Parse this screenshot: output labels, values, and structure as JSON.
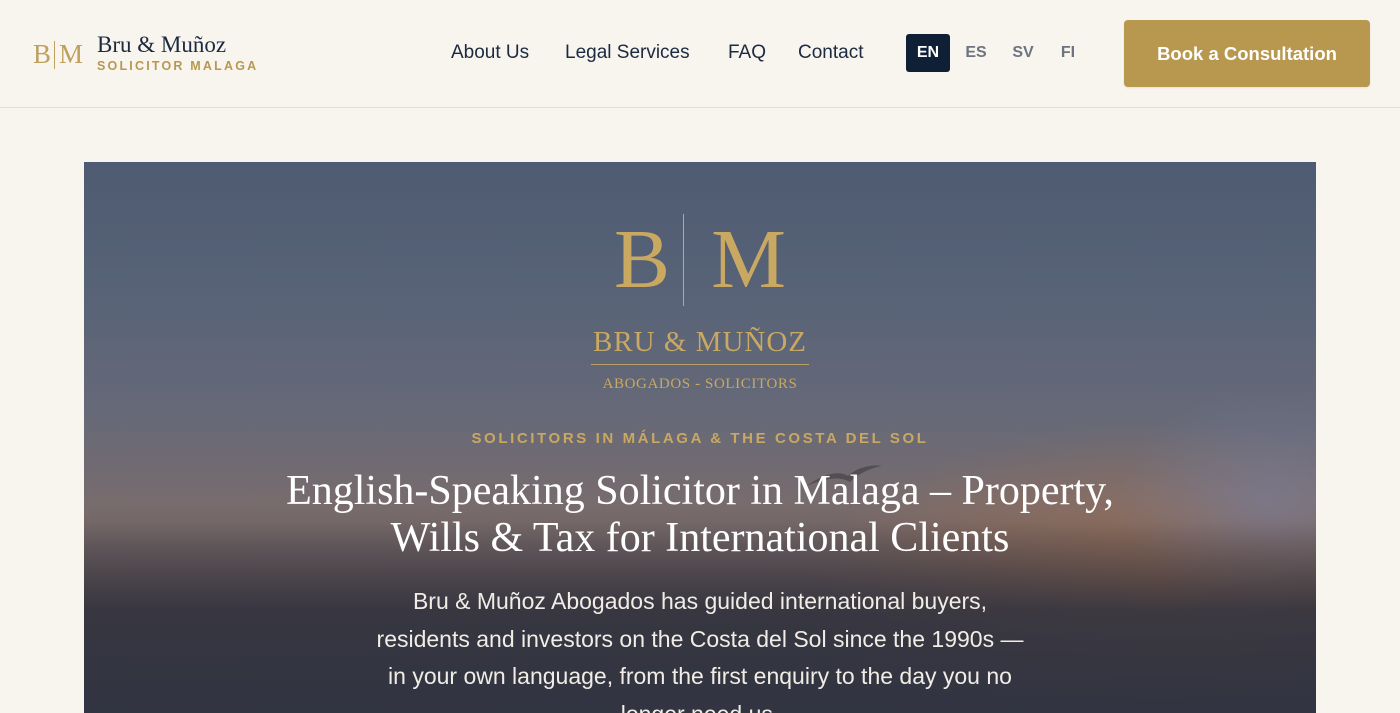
{
  "header": {
    "brand": {
      "mark_b": "B",
      "mark_m": "M",
      "name": "Bru & Muñoz",
      "tagline": "SOLICITOR MALAGA"
    },
    "nav": [
      {
        "label": "About Us"
      },
      {
        "label": "Legal Services"
      },
      {
        "label": "FAQ"
      },
      {
        "label": "Contact"
      }
    ],
    "languages": [
      {
        "code": "EN",
        "active": true
      },
      {
        "code": "ES",
        "active": false
      },
      {
        "code": "SV",
        "active": false
      },
      {
        "code": "FI",
        "active": false
      }
    ],
    "cta_label": "Book a Consultation"
  },
  "hero": {
    "logo": {
      "b": "B",
      "m": "M",
      "firm": "BRU & MUÑOZ",
      "sub": "ABOGADOS - SOLICITORS"
    },
    "eyebrow": "SOLICITORS IN MÁLAGA & THE COSTA DEL SOL",
    "headline_line1": "English-Speaking Solicitor in Malaga – Property,",
    "headline_line2": "Wills & Tax for International Clients",
    "lead": "Bru & Muñoz Abogados has guided international buyers, residents and investors on the Costa del Sol since the 1990s — in your own language, from the first enquiry to the day you no longer need us."
  },
  "colors": {
    "gold": "#b8984f",
    "navy": "#0f1f36",
    "background": "#f8f5ef"
  }
}
